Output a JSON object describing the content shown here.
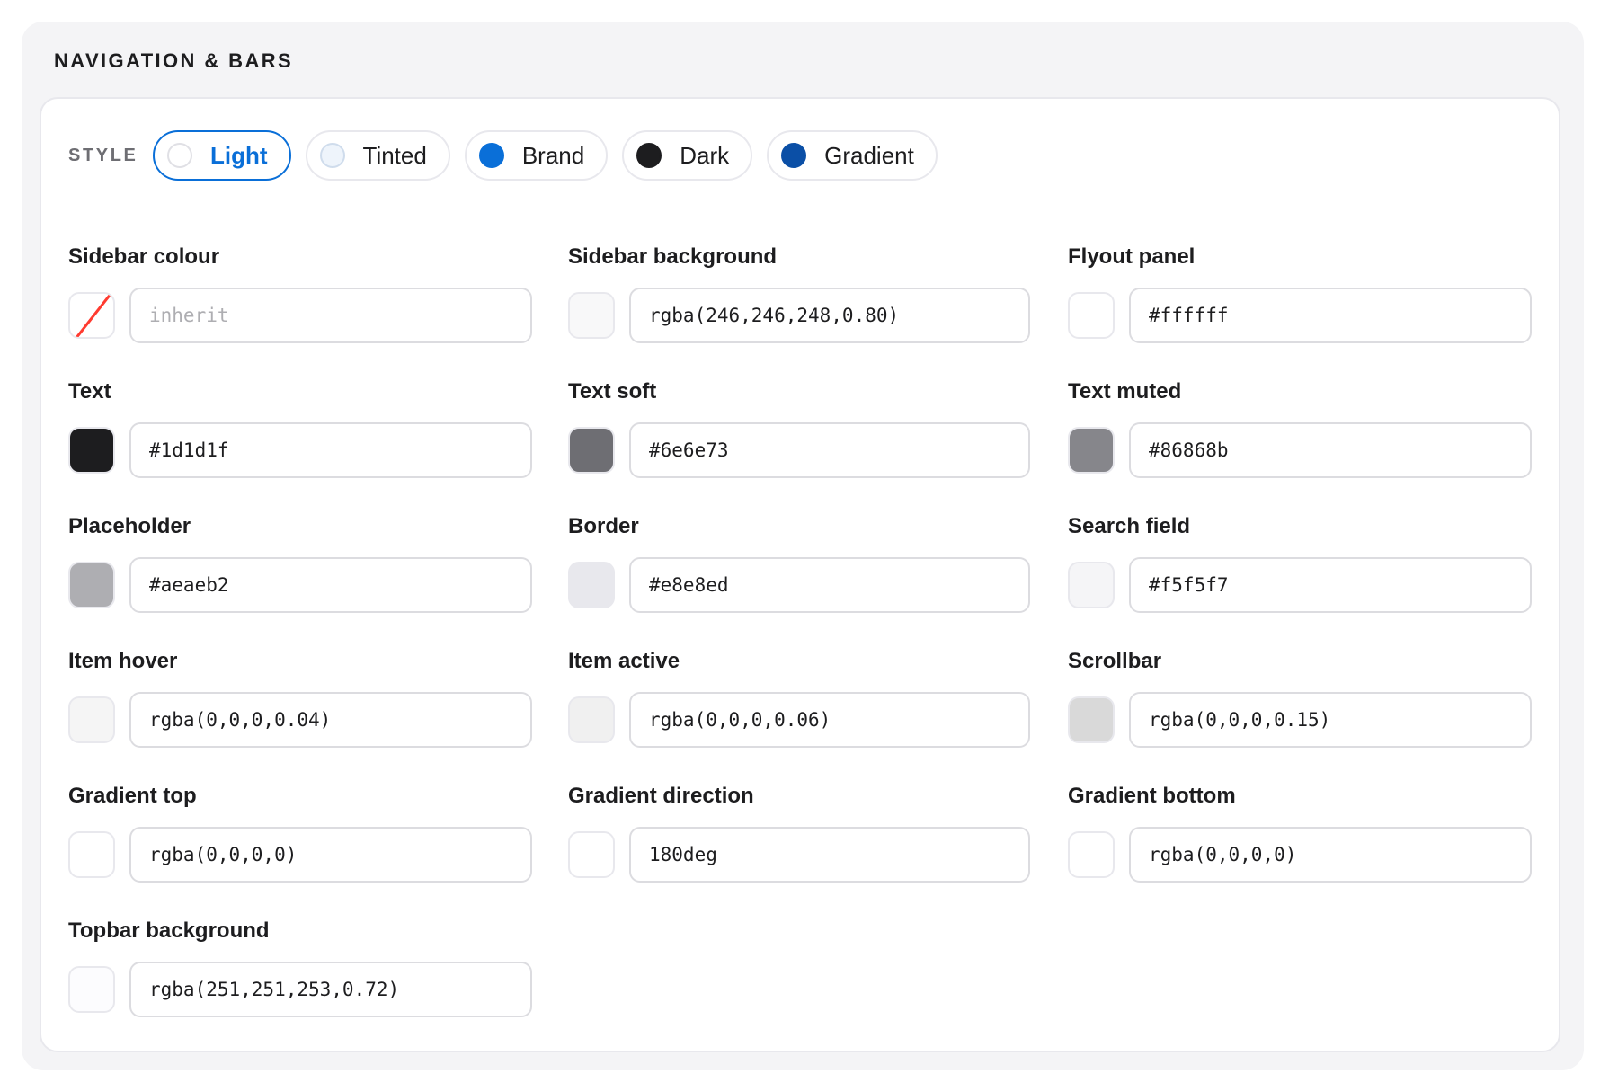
{
  "section": {
    "title": "NAVIGATION & BARS"
  },
  "style": {
    "label": "STYLE",
    "options": [
      {
        "label": "Light",
        "dot_color": "#ffffff",
        "dot_border": "#e0e0e5",
        "active": true
      },
      {
        "label": "Tinted",
        "dot_color": "#eef4fb",
        "dot_border": "#cfdcec",
        "active": false
      },
      {
        "label": "Brand",
        "dot_color": "#0a6fd8",
        "dot_border": "#0a6fd8",
        "active": false
      },
      {
        "label": "Dark",
        "dot_color": "#1d1d1f",
        "dot_border": "#1d1d1f",
        "active": false
      },
      {
        "label": "Gradient",
        "dot_color": "#0b4fa6",
        "dot_border": "#0b4fa6",
        "active": false
      }
    ]
  },
  "fields": [
    {
      "label": "Sidebar colour",
      "value": "",
      "placeholder": "inherit",
      "swatch": "none"
    },
    {
      "label": "Sidebar background",
      "value": "rgba(246,246,248,0.80)",
      "placeholder": "",
      "swatch": "rgba(246,246,248,0.80)"
    },
    {
      "label": "Flyout panel",
      "value": "#ffffff",
      "placeholder": "",
      "swatch": "#ffffff"
    },
    {
      "label": "Text",
      "value": "#1d1d1f",
      "placeholder": "",
      "swatch": "#1d1d1f"
    },
    {
      "label": "Text soft",
      "value": "#6e6e73",
      "placeholder": "",
      "swatch": "#6e6e73"
    },
    {
      "label": "Text muted",
      "value": "#86868b",
      "placeholder": "",
      "swatch": "#86868b"
    },
    {
      "label": "Placeholder",
      "value": "#aeaeb2",
      "placeholder": "",
      "swatch": "#aeaeb2"
    },
    {
      "label": "Border",
      "value": "#e8e8ed",
      "placeholder": "",
      "swatch": "#e8e8ed"
    },
    {
      "label": "Search field",
      "value": "#f5f5f7",
      "placeholder": "",
      "swatch": "#f5f5f7"
    },
    {
      "label": "Item hover",
      "value": "rgba(0,0,0,0.04)",
      "placeholder": "",
      "swatch": "rgba(0,0,0,0.04)"
    },
    {
      "label": "Item active",
      "value": "rgba(0,0,0,0.06)",
      "placeholder": "",
      "swatch": "rgba(0,0,0,0.06)"
    },
    {
      "label": "Scrollbar",
      "value": "rgba(0,0,0,0.15)",
      "placeholder": "",
      "swatch": "rgba(0,0,0,0.15)"
    },
    {
      "label": "Gradient top",
      "value": "rgba(0,0,0,0)",
      "placeholder": "",
      "swatch": "rgba(0,0,0,0)"
    },
    {
      "label": "Gradient direction",
      "value": "180deg",
      "placeholder": "",
      "swatch": "#ffffff"
    },
    {
      "label": "Gradient bottom",
      "value": "rgba(0,0,0,0)",
      "placeholder": "",
      "swatch": "rgba(0,0,0,0)"
    },
    {
      "label": "Topbar background",
      "value": "rgba(251,251,253,0.72)",
      "placeholder": "",
      "swatch": "rgba(251,251,253,0.72)"
    }
  ]
}
